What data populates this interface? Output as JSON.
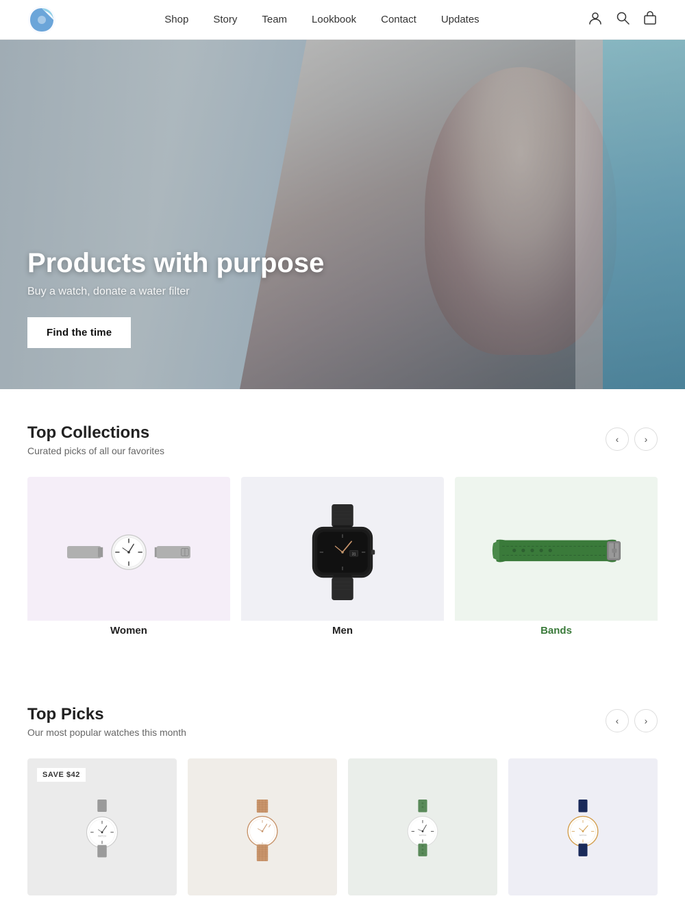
{
  "nav": {
    "logo_alt": "Brand Logo",
    "links": [
      {
        "label": "Shop",
        "href": "#"
      },
      {
        "label": "Story",
        "href": "#"
      },
      {
        "label": "Team",
        "href": "#"
      },
      {
        "label": "Lookbook",
        "href": "#"
      },
      {
        "label": "Contact",
        "href": "#"
      },
      {
        "label": "Updates",
        "href": "#"
      }
    ]
  },
  "hero": {
    "title": "Products with purpose",
    "subtitle": "Buy a watch, donate a water filter",
    "cta_label": "Find the time"
  },
  "top_collections": {
    "title": "Top Collections",
    "subtitle": "Curated picks of all our favorites",
    "items": [
      {
        "label": "Women",
        "bg": "card-women"
      },
      {
        "label": "Men",
        "bg": "card-men"
      },
      {
        "label": "Bands",
        "bg": "card-bands"
      }
    ]
  },
  "top_picks": {
    "title": "Top Picks",
    "subtitle": "Our most popular watches this month",
    "items": [
      {
        "save_badge": "SAVE $42",
        "bg": "#f0f0f0"
      },
      {
        "save_badge": null,
        "bg": "#f5f5f5"
      },
      {
        "save_badge": null,
        "bg": "#f0f2f0"
      },
      {
        "save_badge": null,
        "bg": "#f0f0f5"
      }
    ]
  },
  "icons": {
    "user": "👤",
    "search": "🔍",
    "bag": "🛍",
    "chevron_left": "‹",
    "chevron_right": "›"
  }
}
